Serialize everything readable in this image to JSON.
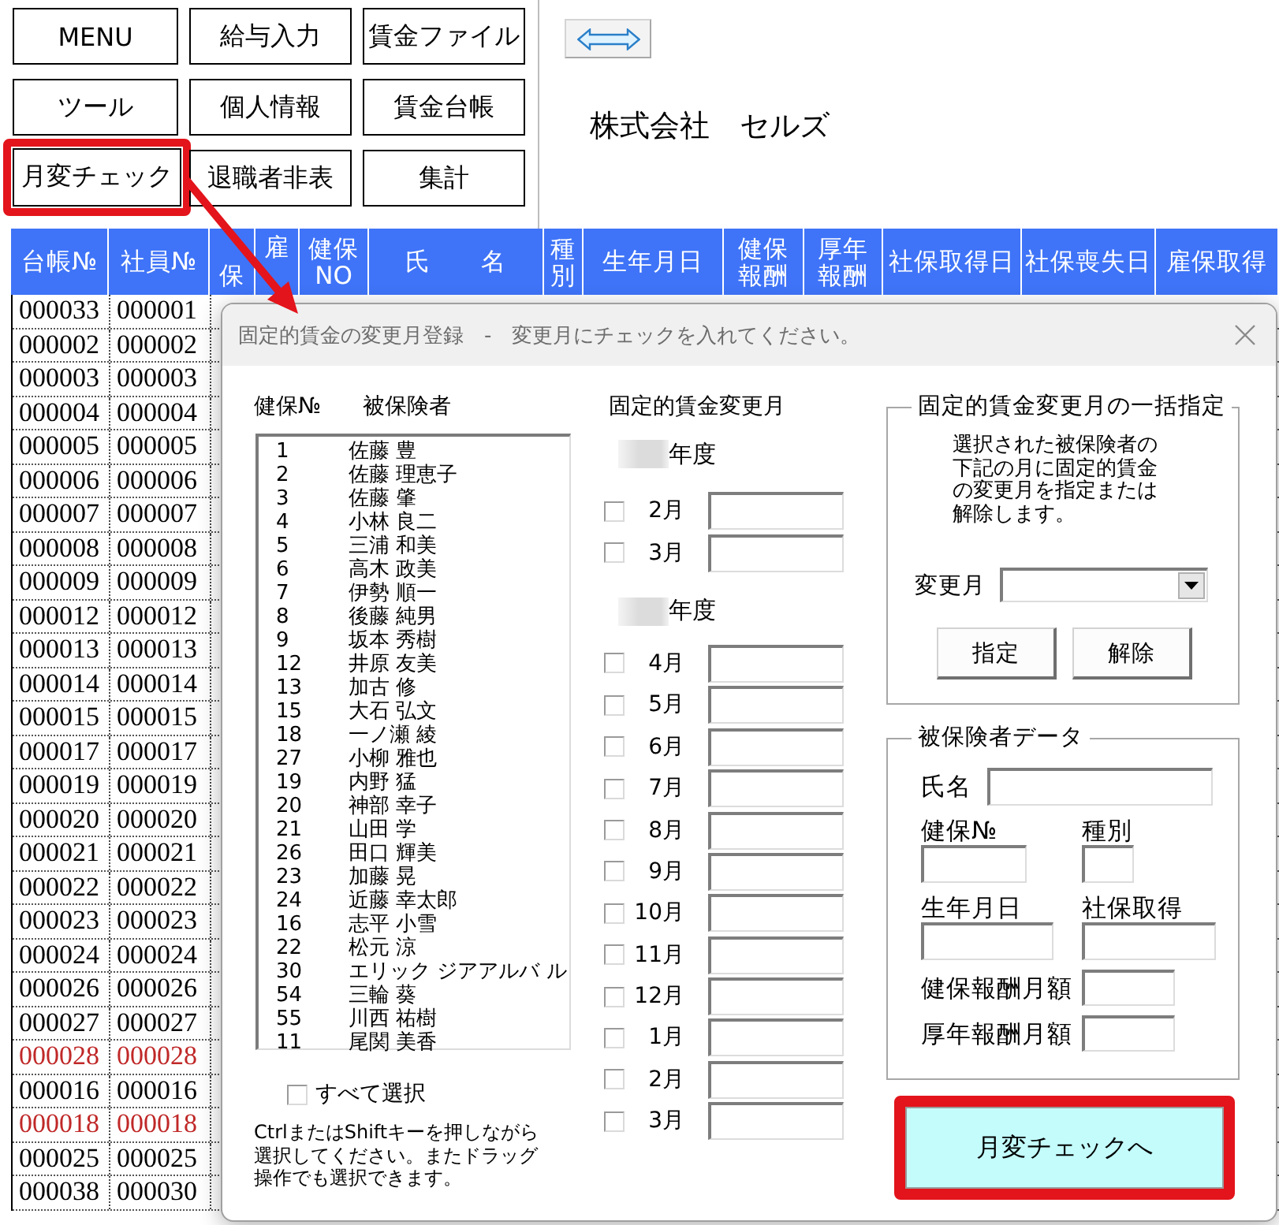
{
  "menu_buttons": [
    {
      "label": "MENU",
      "highlighted": false
    },
    {
      "label": "給与入力",
      "highlighted": false
    },
    {
      "label": "賃金ファイル",
      "highlighted": false
    },
    {
      "label": "ツール",
      "highlighted": false
    },
    {
      "label": "個人情報",
      "highlighted": false
    },
    {
      "label": "賃金台帳",
      "highlighted": false
    },
    {
      "label": "月変チェック",
      "highlighted": true
    },
    {
      "label": "退職者非表",
      "highlighted": false
    },
    {
      "label": "集計",
      "highlighted": false
    }
  ],
  "company_name": "株式会社　セルズ",
  "sheet": {
    "columns": [
      "台帳№",
      "社員№",
      "保",
      "雇",
      "健保NO",
      "氏　　名",
      "種別",
      "生年月日",
      "健保報酬",
      "厚年報酬",
      "社保取得日",
      "社保喪失日",
      "雇保取得"
    ],
    "rows": [
      {
        "cells": [
          "000033",
          "000001"
        ],
        "color": "#000000"
      },
      {
        "cells": [
          "000002",
          "000002"
        ],
        "color": "#000000"
      },
      {
        "cells": [
          "000003",
          "000003"
        ],
        "color": "#000000"
      },
      {
        "cells": [
          "000004",
          "000004"
        ],
        "color": "#000000"
      },
      {
        "cells": [
          "000005",
          "000005"
        ],
        "color": "#000000"
      },
      {
        "cells": [
          "000006",
          "000006"
        ],
        "color": "#000000"
      },
      {
        "cells": [
          "000007",
          "000007"
        ],
        "color": "#000000"
      },
      {
        "cells": [
          "000008",
          "000008"
        ],
        "color": "#000000"
      },
      {
        "cells": [
          "000009",
          "000009"
        ],
        "color": "#000000"
      },
      {
        "cells": [
          "000012",
          "000012"
        ],
        "color": "#000000"
      },
      {
        "cells": [
          "000013",
          "000013"
        ],
        "color": "#000000"
      },
      {
        "cells": [
          "000014",
          "000014"
        ],
        "color": "#000000"
      },
      {
        "cells": [
          "000015",
          "000015"
        ],
        "color": "#000000"
      },
      {
        "cells": [
          "000017",
          "000017"
        ],
        "color": "#000000"
      },
      {
        "cells": [
          "000019",
          "000019"
        ],
        "color": "#000000"
      },
      {
        "cells": [
          "000020",
          "000020"
        ],
        "color": "#000000"
      },
      {
        "cells": [
          "000021",
          "000021"
        ],
        "color": "#000000"
      },
      {
        "cells": [
          "000022",
          "000022"
        ],
        "color": "#000000"
      },
      {
        "cells": [
          "000023",
          "000023"
        ],
        "color": "#000000"
      },
      {
        "cells": [
          "000024",
          "000024"
        ],
        "color": "#000000"
      },
      {
        "cells": [
          "000026",
          "000026"
        ],
        "color": "#000000"
      },
      {
        "cells": [
          "000027",
          "000027"
        ],
        "color": "#000000"
      },
      {
        "cells": [
          "000028",
          "000028"
        ],
        "color": "#c02828"
      },
      {
        "cells": [
          "000016",
          "000016"
        ],
        "color": "#000000"
      },
      {
        "cells": [
          "000018",
          "000018"
        ],
        "color": "#c02828"
      },
      {
        "cells": [
          "000025",
          "000025"
        ],
        "color": "#000000"
      },
      {
        "cells": [
          "000038",
          "000030"
        ],
        "color": "#000000"
      }
    ]
  },
  "dialog": {
    "title": "固定的賃金の変更月登録　-　変更月にチェックを入れてください。",
    "list_headers": [
      "健保№",
      "被保険者"
    ],
    "insured": [
      {
        "no": "1",
        "name": "佐藤 豊",
        "selected": false
      },
      {
        "no": "2",
        "name": "佐藤 理恵子",
        "selected": false
      },
      {
        "no": "3",
        "name": "佐藤 肇",
        "selected": false
      },
      {
        "no": "4",
        "name": "小林 良二",
        "selected": false
      },
      {
        "no": "5",
        "name": "三浦 和美",
        "selected": false
      },
      {
        "no": "6",
        "name": "高木 政美",
        "selected": false
      },
      {
        "no": "7",
        "name": "伊勢 順一",
        "selected": false
      },
      {
        "no": "8",
        "name": "後藤 純男",
        "selected": false
      },
      {
        "no": "9",
        "name": "坂本 秀樹",
        "selected": false
      },
      {
        "no": "12",
        "name": "井原 友美",
        "selected": false
      },
      {
        "no": "13",
        "name": "加古 修",
        "selected": false
      },
      {
        "no": "15",
        "name": "大石 弘文",
        "selected": false
      },
      {
        "no": "18",
        "name": "一ノ瀬 綾",
        "selected": false
      },
      {
        "no": "27",
        "name": "小柳 雅也",
        "selected": false
      },
      {
        "no": "19",
        "name": "内野 猛",
        "selected": false
      },
      {
        "no": "20",
        "name": "神部 幸子",
        "selected": false
      },
      {
        "no": "21",
        "name": "山田 学",
        "selected": false
      },
      {
        "no": "26",
        "name": "田口 輝美",
        "selected": false
      },
      {
        "no": "23",
        "name": "加藤 晃",
        "selected": false
      },
      {
        "no": "24",
        "name": "近藤 幸太郎",
        "selected": false
      },
      {
        "no": "16",
        "name": "志平 小雪",
        "selected": false
      },
      {
        "no": "22",
        "name": "松元 涼",
        "selected": false
      },
      {
        "no": "30",
        "name": "エリック ジアアルバ ル",
        "selected": false
      },
      {
        "no": "54",
        "name": "三輪 葵",
        "selected": false
      },
      {
        "no": "55",
        "name": "川西 祐樹",
        "selected": false
      },
      {
        "no": "11",
        "name": "尾関 美香",
        "selected": false
      }
    ],
    "select_all": {
      "label": "すべて選択",
      "checked": false
    },
    "note": "CtrlまたはShiftキーを押しながら選択してください。またドラッグ操作でも選択できます。",
    "months_title": "固定的賃金変更月",
    "fiscal_years": [
      {
        "label": "年度",
        "months": [
          {
            "label": "2月",
            "checked": false
          },
          {
            "label": "3月",
            "checked": false
          }
        ]
      },
      {
        "label": "年度",
        "months": [
          {
            "label": "4月",
            "checked": false
          },
          {
            "label": "5月",
            "checked": false
          },
          {
            "label": "6月",
            "checked": false
          },
          {
            "label": "7月",
            "checked": false
          },
          {
            "label": "8月",
            "checked": false
          },
          {
            "label": "9月",
            "checked": false
          },
          {
            "label": "10月",
            "checked": false
          },
          {
            "label": "11月",
            "checked": false
          },
          {
            "label": "12月",
            "checked": false
          },
          {
            "label": "1月",
            "checked": false
          },
          {
            "label": "2月",
            "checked": false
          },
          {
            "label": "3月",
            "checked": false
          }
        ]
      }
    ],
    "bulk": {
      "title": "固定的賃金変更月の一括指定",
      "description": "選択された被保険者の下記の月に固定的賃金の変更月を指定または解除します。",
      "month_label": "変更月",
      "buttons": [
        "指定",
        "解除"
      ]
    },
    "insured_data": {
      "title": "被保険者データ",
      "rows": [
        {
          "kind": "inline",
          "fields": [
            {
              "label": "氏名"
            }
          ]
        },
        {
          "kind": "stacked",
          "fields": [
            {
              "label": "健保№"
            },
            {
              "label": "種別"
            }
          ]
        },
        {
          "kind": "stacked",
          "fields": [
            {
              "label": "生年月日"
            },
            {
              "label": "社保取得"
            }
          ]
        },
        {
          "kind": "inline",
          "fields": [
            {
              "label": "健保報酬月額"
            }
          ]
        },
        {
          "kind": "inline",
          "fields": [
            {
              "label": "厚年報酬月額"
            }
          ]
        }
      ]
    },
    "submit": {
      "label": "月変チェックへ",
      "highlighted": true
    }
  }
}
